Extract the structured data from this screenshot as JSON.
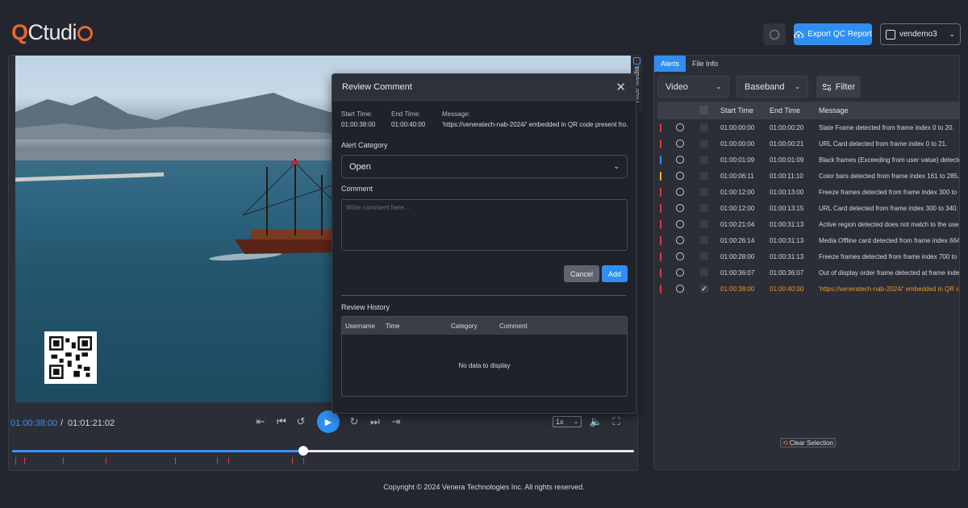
{
  "header": {
    "logo_q": "Q",
    "logo_rest": "Ctudi",
    "export_label": "Export QC Report",
    "username": "vendemo3",
    "chevron": "⌄"
  },
  "hide_media_label": "Hide Media",
  "player": {
    "current_time": "01:00:38:00",
    "separator": "/",
    "total_time": "01:01:21:02",
    "speed": "1x",
    "progress": 0.468,
    "alert_markers": [
      0.005,
      0.02,
      0.082,
      0.15,
      0.262,
      0.33,
      0.348,
      0.45,
      0.468
    ]
  },
  "modal": {
    "title": "Review Comment",
    "close": "✕",
    "start_time_label": "Start Time:",
    "start_time": "01:00:38:00",
    "end_time_label": "End Time:",
    "end_time": "01:00:40:00",
    "message_label": "Message:",
    "message": "'https://veneratech-nab-2024/' embedded in QR code present fro...",
    "alert_category_label": "Alert Category",
    "alert_category_value": "Open",
    "comment_label": "Comment",
    "comment_placeholder": "Write comment here...",
    "cancel_label": "Cancel",
    "add_label": "Add",
    "history_label": "Review History",
    "history_columns": [
      "Username",
      "Time",
      "Category",
      "Comment"
    ],
    "history_empty": "No data to display"
  },
  "alerts_panel": {
    "tabs": [
      "Alerts",
      "File Info"
    ],
    "filter_video": "Video",
    "filter_baseband": "Baseband",
    "filter_label": "Filter",
    "columns": [
      "Start Time",
      "End Time",
      "Message"
    ],
    "rows": [
      {
        "start": "01:00:00:00",
        "end": "01:00:00:20",
        "message": "Slate Frame detected from frame index 0 to 20.",
        "severity_color": "#e0353e",
        "checked": false
      },
      {
        "start": "01:00:00:00",
        "end": "01:00:00:21",
        "message": "URL Card detected from frame index 0 to 21.",
        "severity_color": "#e0353e",
        "checked": false
      },
      {
        "start": "01:00:01:09",
        "end": "01:00:01:09",
        "message": "Black frames (Exceeding from user value) detected",
        "severity_color": "#3f8ff0",
        "checked": false
      },
      {
        "start": "01:00:06:11",
        "end": "01:00:11:10",
        "message": "Color bars detected from frame index 161 to 285.",
        "severity_color": "#e8b52e",
        "checked": false
      },
      {
        "start": "01:00:12:00",
        "end": "01:00:13:00",
        "message": "Freeze frames detected from frame index 300 to 325",
        "severity_color": "#e0353e",
        "checked": false
      },
      {
        "start": "01:00:12:00",
        "end": "01:00:13:15",
        "message": "URL Card detected from frame index 300 to 340.",
        "severity_color": "#e0353e",
        "checked": false
      },
      {
        "start": "01:00:21:04",
        "end": "01:00:31:13",
        "message": "Active region detected does not match to the user",
        "severity_color": "#e0353e",
        "checked": false
      },
      {
        "start": "01:00:26:14",
        "end": "01:00:31:13",
        "message": "Media Offline card detected from frame index 664 t",
        "severity_color": "#e0353e",
        "checked": false
      },
      {
        "start": "01:00:28:00",
        "end": "01:00:31:13",
        "message": "Freeze frames detected from frame index 700 to 78",
        "severity_color": "#e0353e",
        "checked": false
      },
      {
        "start": "01:00:36:07",
        "end": "01:00:36:07",
        "message": "Out of display order frame detected at frame index",
        "severity_color": "#e0353e",
        "checked": false
      },
      {
        "start": "01:00:38:00",
        "end": "01:00:40:00",
        "message": "'https://veneratech-nab-2024/' embedded in QR co",
        "severity_color": "#e0353e",
        "checked": true
      }
    ],
    "clear_selection_label": "Clear Selection"
  },
  "footer": "Copyright © 2024 Venera Technologies Inc. All rights reserved."
}
